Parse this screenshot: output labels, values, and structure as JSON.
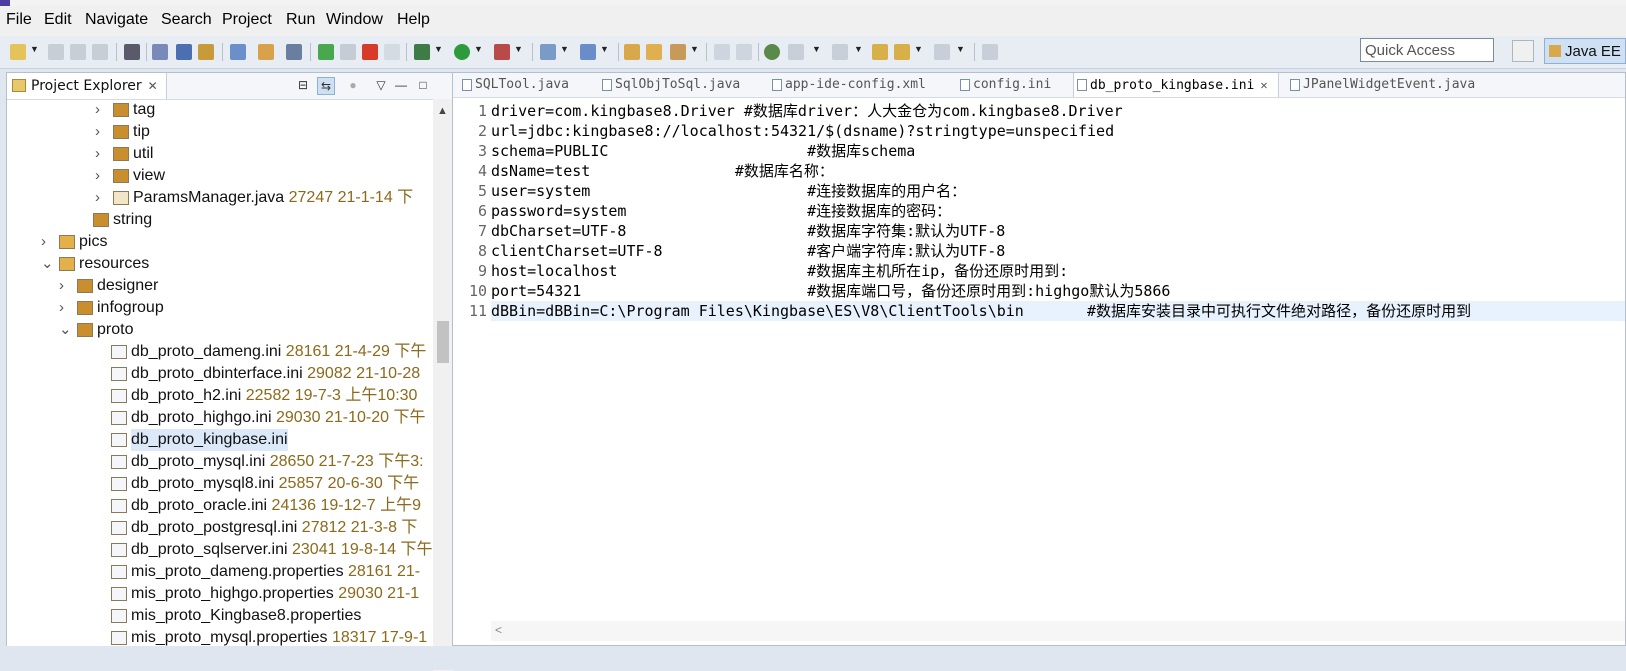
{
  "menu": [
    "File",
    "Edit",
    "Navigate",
    "Search",
    "Project",
    "Run",
    "Window",
    "Help"
  ],
  "toolbar": {
    "quick_access": "Quick Access",
    "perspective": "Java EE"
  },
  "explorer": {
    "title": "Project Explorer",
    "close": "✕",
    "tree": [
      {
        "label": "tag",
        "meta": "",
        "expanded": false,
        "icon": "package-icon"
      },
      {
        "label": "tip",
        "meta": "",
        "expanded": false,
        "icon": "package-icon"
      },
      {
        "label": "util",
        "meta": "",
        "expanded": false,
        "icon": "package-icon"
      },
      {
        "label": "view",
        "meta": "",
        "expanded": false,
        "icon": "package-icon"
      },
      {
        "label": "ParamsManager.java",
        "meta": "27247  21-1-14 下",
        "expanded": false,
        "icon": "java-file-icon"
      },
      {
        "label": "string",
        "meta": "",
        "expanded": null,
        "icon": "package-icon"
      },
      {
        "label": "pics",
        "meta": "",
        "expanded": false,
        "icon": "folder-icon"
      },
      {
        "label": "resources",
        "meta": "",
        "expanded": true,
        "icon": "folder-icon"
      },
      {
        "label": "designer",
        "meta": "",
        "expanded": false,
        "icon": "package-icon"
      },
      {
        "label": "infogroup",
        "meta": "",
        "expanded": false,
        "icon": "package-icon"
      },
      {
        "label": "proto",
        "meta": "",
        "expanded": true,
        "icon": "package-icon"
      },
      {
        "label": "db_proto_dameng.ini",
        "meta": "28161  21-4-29 下午",
        "icon": "ini-file-icon"
      },
      {
        "label": "db_proto_dbinterface.ini",
        "meta": "29082  21-10-28",
        "icon": "ini-file-icon"
      },
      {
        "label": "db_proto_h2.ini",
        "meta": "22582  19-7-3 上午10:30",
        "icon": "ini-file-icon"
      },
      {
        "label": "db_proto_highgo.ini",
        "meta": "29030  21-10-20 下午",
        "icon": "ini-file-icon"
      },
      {
        "label": "db_proto_kingbase.ini",
        "meta": "",
        "icon": "ini-file-icon",
        "selected": true
      },
      {
        "label": "db_proto_mysql.ini",
        "meta": "28650  21-7-23 下午3:",
        "icon": "ini-file-icon"
      },
      {
        "label": "db_proto_mysql8.ini",
        "meta": "25857  20-6-30 下午",
        "icon": "ini-file-icon"
      },
      {
        "label": "db_proto_oracle.ini",
        "meta": "24136  19-12-7 上午9",
        "icon": "ini-file-icon"
      },
      {
        "label": "db_proto_postgresql.ini",
        "meta": "27812  21-3-8 下",
        "icon": "ini-file-icon"
      },
      {
        "label": "db_proto_sqlserver.ini",
        "meta": "23041  19-8-14 下午",
        "icon": "ini-file-icon"
      },
      {
        "label": "mis_proto_dameng.properties",
        "meta": "28161  21-",
        "icon": "properties-file-icon"
      },
      {
        "label": "mis_proto_highgo.properties",
        "meta": "29030  21-1",
        "icon": "properties-file-icon"
      },
      {
        "label": "mis_proto_Kingbase8.properties",
        "meta": "",
        "icon": "properties-file-icon"
      },
      {
        "label": "mis_proto_mysql.properties",
        "meta": "18317  17-9-1",
        "icon": "properties-file-icon"
      }
    ]
  },
  "editor": {
    "tabs": [
      {
        "label": "SQLTool.java",
        "active": false
      },
      {
        "label": "SqlObjToSql.java",
        "active": false
      },
      {
        "label": "app-ide-config.xml",
        "active": false
      },
      {
        "label": "config.ini",
        "active": false
      },
      {
        "label": "db_proto_kingbase.ini",
        "active": true
      },
      {
        "label": "JPanelWidgetEvent.java",
        "active": false
      }
    ],
    "lines": [
      "driver=com.kingbase8.Driver #数据库driver：人大金仓为com.kingbase8.Driver",
      "url=jdbc:kingbase8://localhost:54321/$(dsname)?stringtype=unspecified",
      "schema=PUBLIC                      #数据库schema",
      "dsName=test                #数据库名称：",
      "user=system                        #连接数据库的用户名：",
      "password=system                    #连接数据库的密码：",
      "dbCharset=UTF-8                    #数据库字符集:默认为UTF-8",
      "clientCharset=UTF-8                #客户端字符库:默认为UTF-8",
      "host=localhost                     #数据库主机所在ip，备份还原时用到:",
      "port=54321                         #数据库端口号，备份还原时用到:highgo默认为5866",
      "dBBin=dBBin=C:\\Program Files\\Kingbase\\ES\\V8\\ClientTools\\bin       #数据库安装目录中可执行文件绝对路径，备份还原时用到"
    ]
  },
  "colors": {
    "accent": "#cfe0f3",
    "selection": "#dbe9f8",
    "current_line": "#e8f2fe",
    "meta_text": "#8b6a1c"
  }
}
